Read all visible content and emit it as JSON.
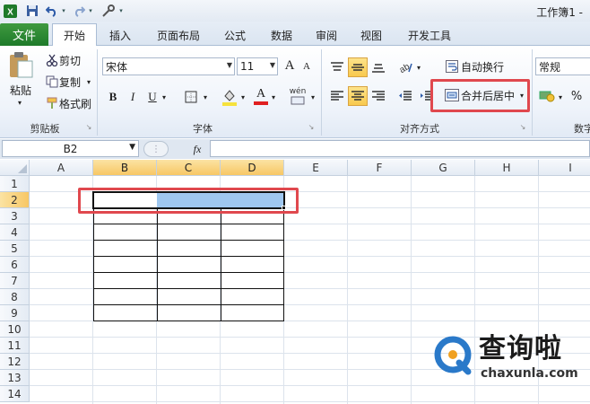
{
  "titlebar": {
    "title": "工作簿1 -"
  },
  "tabs": {
    "file": "文件",
    "items": [
      "开始",
      "插入",
      "页面布局",
      "公式",
      "数据",
      "审阅",
      "视图",
      "开发工具"
    ]
  },
  "clipboard": {
    "paste": "粘贴",
    "cut": "剪切",
    "copy": "复制",
    "format_painter": "格式刷",
    "label": "剪贴板"
  },
  "font": {
    "name": "宋体",
    "size": "11",
    "grow": "A",
    "shrink": "A",
    "bold": "B",
    "italic": "I",
    "underline": "U",
    "font_color_letter": "A",
    "phonetic": "wén",
    "label": "字体"
  },
  "alignment": {
    "wrap_text": "自动换行",
    "merge_center": "合并后居中",
    "label": "对齐方式"
  },
  "number": {
    "format": "常规",
    "percent": "%",
    "label": "数字"
  },
  "formula_bar": {
    "name_box": "B2",
    "fx": "fx"
  },
  "grid": {
    "columns": [
      "A",
      "B",
      "C",
      "D",
      "E",
      "F",
      "G",
      "H",
      "I"
    ],
    "rows": [
      "1",
      "2",
      "3",
      "4",
      "5",
      "6",
      "7",
      "8",
      "9",
      "10",
      "11",
      "12",
      "13",
      "14"
    ],
    "active_cell": "B2",
    "selection": "B2:D2",
    "selection_color": "#9fc7ef"
  },
  "watermark": {
    "brand": "查询啦",
    "domain": "chaxunla.com"
  },
  "colors": {
    "accent_red": "#e0484e",
    "file_tab": "#2a8a34",
    "selected_header": "#f7c765"
  }
}
